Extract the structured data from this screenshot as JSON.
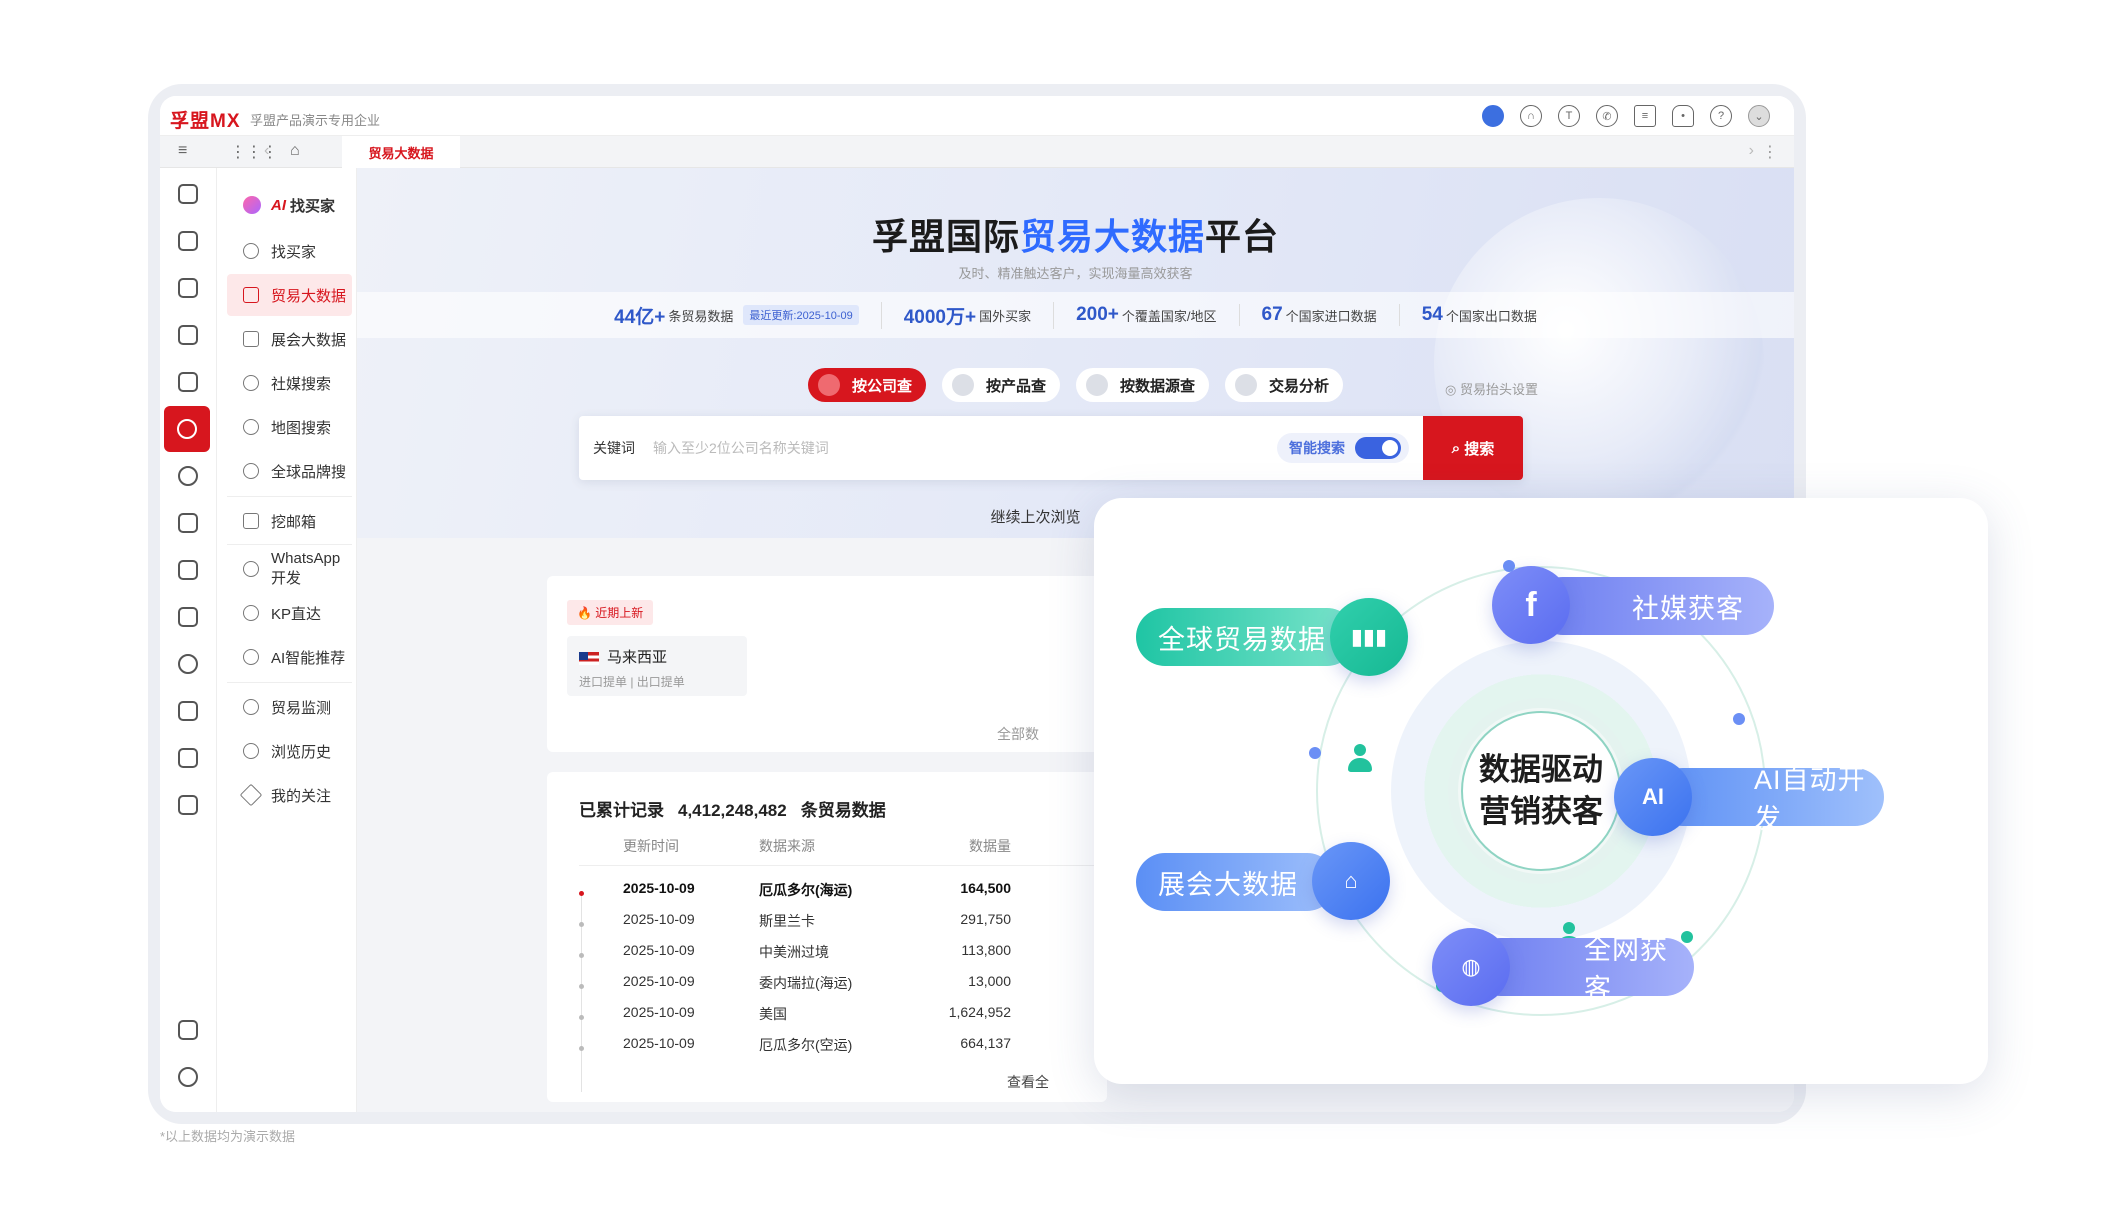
{
  "app": {
    "logo": "孚盟MX",
    "company": "孚盟产品演示专用企业"
  },
  "tabs": {
    "active": "贸易大数据"
  },
  "header_icons": [
    "chat-bot-icon",
    "headset-icon",
    "translate-icon",
    "whatsapp-icon",
    "task-icon",
    "bell-icon",
    "help-icon",
    "user-avatar-icon"
  ],
  "rail_icons": [
    "home-icon",
    "contacts-icon",
    "org-icon",
    "mail-icon",
    "inbox-icon",
    "compass-icon",
    "app-icon",
    "money-icon",
    "doc-icon",
    "truck-icon",
    "bag-icon",
    "book-icon",
    "chart-icon",
    "message-icon",
    "settings-sliders-icon",
    "gear-icon"
  ],
  "sidebar": {
    "ai_prefix": "AI",
    "ai_label": "找买家",
    "items": [
      "找买家",
      "贸易大数据",
      "展会大数据",
      "社媒搜索",
      "地图搜索",
      "全球品牌搜",
      "挖邮箱",
      "WhatsApp开发",
      "KP直达",
      "AI智能推荐",
      "贸易监测",
      "浏览历史",
      "我的关注"
    ]
  },
  "hero": {
    "title_a": "孚盟国际",
    "title_b": "贸易大数据",
    "title_c": "平台",
    "subtitle": "及时、精准触达客户，实现海量高效获客",
    "stats": [
      {
        "num": "44亿+",
        "text": "条贸易数据",
        "update": "最近更新:2025-10-09"
      },
      {
        "num": "4000万+",
        "text": "国外买家"
      },
      {
        "num": "200+",
        "text": "个覆盖国家/地区"
      },
      {
        "num": "67",
        "text": "个国家进口数据"
      },
      {
        "num": "54",
        "text": "个国家出口数据"
      }
    ],
    "query_tabs": [
      "按公司查",
      "按产品查",
      "按数据源查",
      "交易分析"
    ],
    "setting": "贸易抬头设置",
    "search": {
      "label": "关键词",
      "placeholder": "输入至少2位公司名称关键词",
      "smart": "智能搜索",
      "button": "搜索"
    },
    "continue": "继续上次浏览"
  },
  "recent": {
    "badge": "近期上新",
    "country": "马来西亚",
    "country_sub": "进口提单 | 出口提单",
    "all": "全部数"
  },
  "records": {
    "prefix": "已累计记录",
    "count": "4,412,248,482",
    "suffix": "条贸易数据",
    "headers": [
      "更新时间",
      "数据来源",
      "数据量"
    ],
    "rows": [
      [
        "2025-10-09",
        "厄瓜多尔(海运)",
        "164,500"
      ],
      [
        "2025-10-09",
        "斯里兰卡",
        "291,750"
      ],
      [
        "2025-10-09",
        "中美洲过境",
        "113,800"
      ],
      [
        "2025-10-09",
        "委内瑞拉(海运)",
        "13,000"
      ],
      [
        "2025-10-09",
        "美国",
        "1,624,952"
      ],
      [
        "2025-10-09",
        "厄瓜多尔(空运)",
        "664,137"
      ]
    ],
    "view_all": "查看全"
  },
  "panel": {
    "core_l1": "数据驱动",
    "core_l2": "营销获客",
    "features": [
      "全球贸易数据",
      "社媒获客",
      "AI自动开发",
      "展会大数据",
      "全网获客"
    ],
    "ai_badge": "AI"
  },
  "footnote": "*以上数据均为演示数据",
  "colors": {
    "brand": "#d7161e",
    "accent_blue": "#2f6bff",
    "green": "#1fc5a4"
  }
}
